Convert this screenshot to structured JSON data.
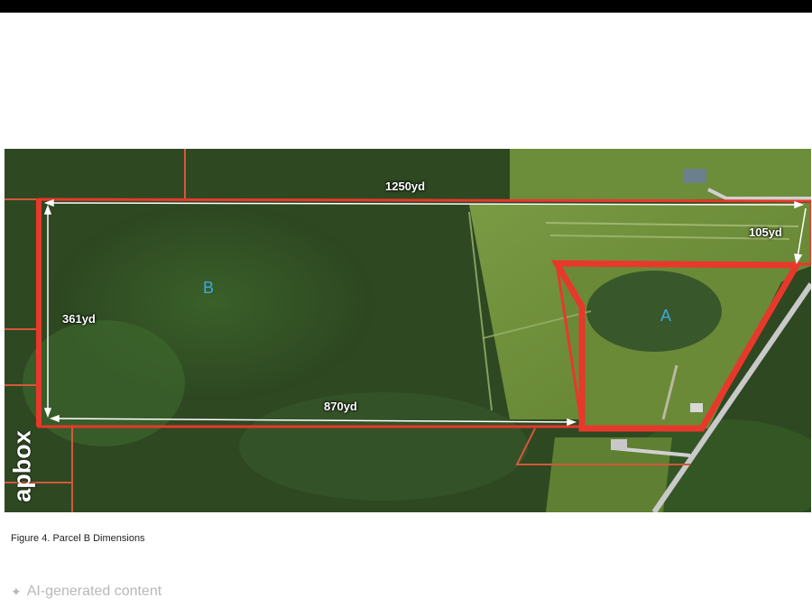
{
  "caption": "Figure 4. Parcel B Dimensions",
  "ai_label": "AI-generated content",
  "ai_icon": "sparkle-icon",
  "watermark": "apbox",
  "parcels": {
    "a": "A",
    "b": "B"
  },
  "dimensions": {
    "top": "1250yd",
    "left": "361yd",
    "bottom": "870yd",
    "right": "105yd"
  },
  "colors": {
    "boundary": "#e8382b",
    "parcel_label": "#3fa9e0",
    "forest": "#2f4a22",
    "field": "#6f8f3a"
  }
}
